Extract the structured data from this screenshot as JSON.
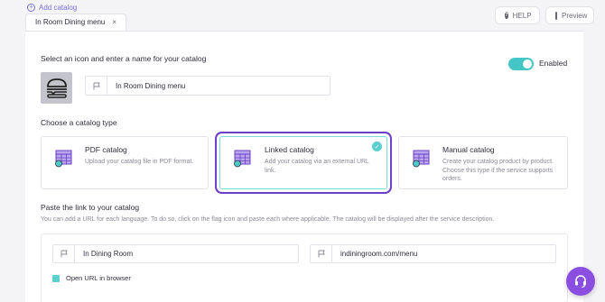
{
  "header": {
    "add_catalog_label": "Add catalog",
    "tab_label": "In Room Dining menu",
    "tab_close": "×",
    "help_label": "HELP",
    "preview_label": "Preview"
  },
  "name_section": {
    "heading": "Select an icon and enter a name for your catalog",
    "enabled_label": "Enabled",
    "enabled": true,
    "catalog_name": "In Room Dining menu",
    "icon": "burger-icon"
  },
  "type_section": {
    "heading": "Choose a catalog type",
    "cards": [
      {
        "title": "PDF catalog",
        "description": "Upload your catalog file in PDF format.",
        "selected": false
      },
      {
        "title": "Linked catalog",
        "description": "Add your catalog via an external URL link.",
        "selected": true
      },
      {
        "title": "Manual catalog",
        "description": "Create your catalog product by product. Choose this type if the service supports orders.",
        "selected": false
      }
    ]
  },
  "link_section": {
    "heading": "Paste the link to your catalog",
    "description": "You can add a URL for each language. To do so, click on the flag icon and paste each where applicable. The catalog will be displayed after the service description.",
    "title_value": "In Dining Room",
    "url_value": "indiningroom.com/menu",
    "open_in_browser_label": "Open URL in browser",
    "open_in_browser": true
  },
  "colors": {
    "accent_teal": "#45c6c6",
    "selected_outline": "#6b3fc7",
    "support_button": "#8a4fe0"
  }
}
